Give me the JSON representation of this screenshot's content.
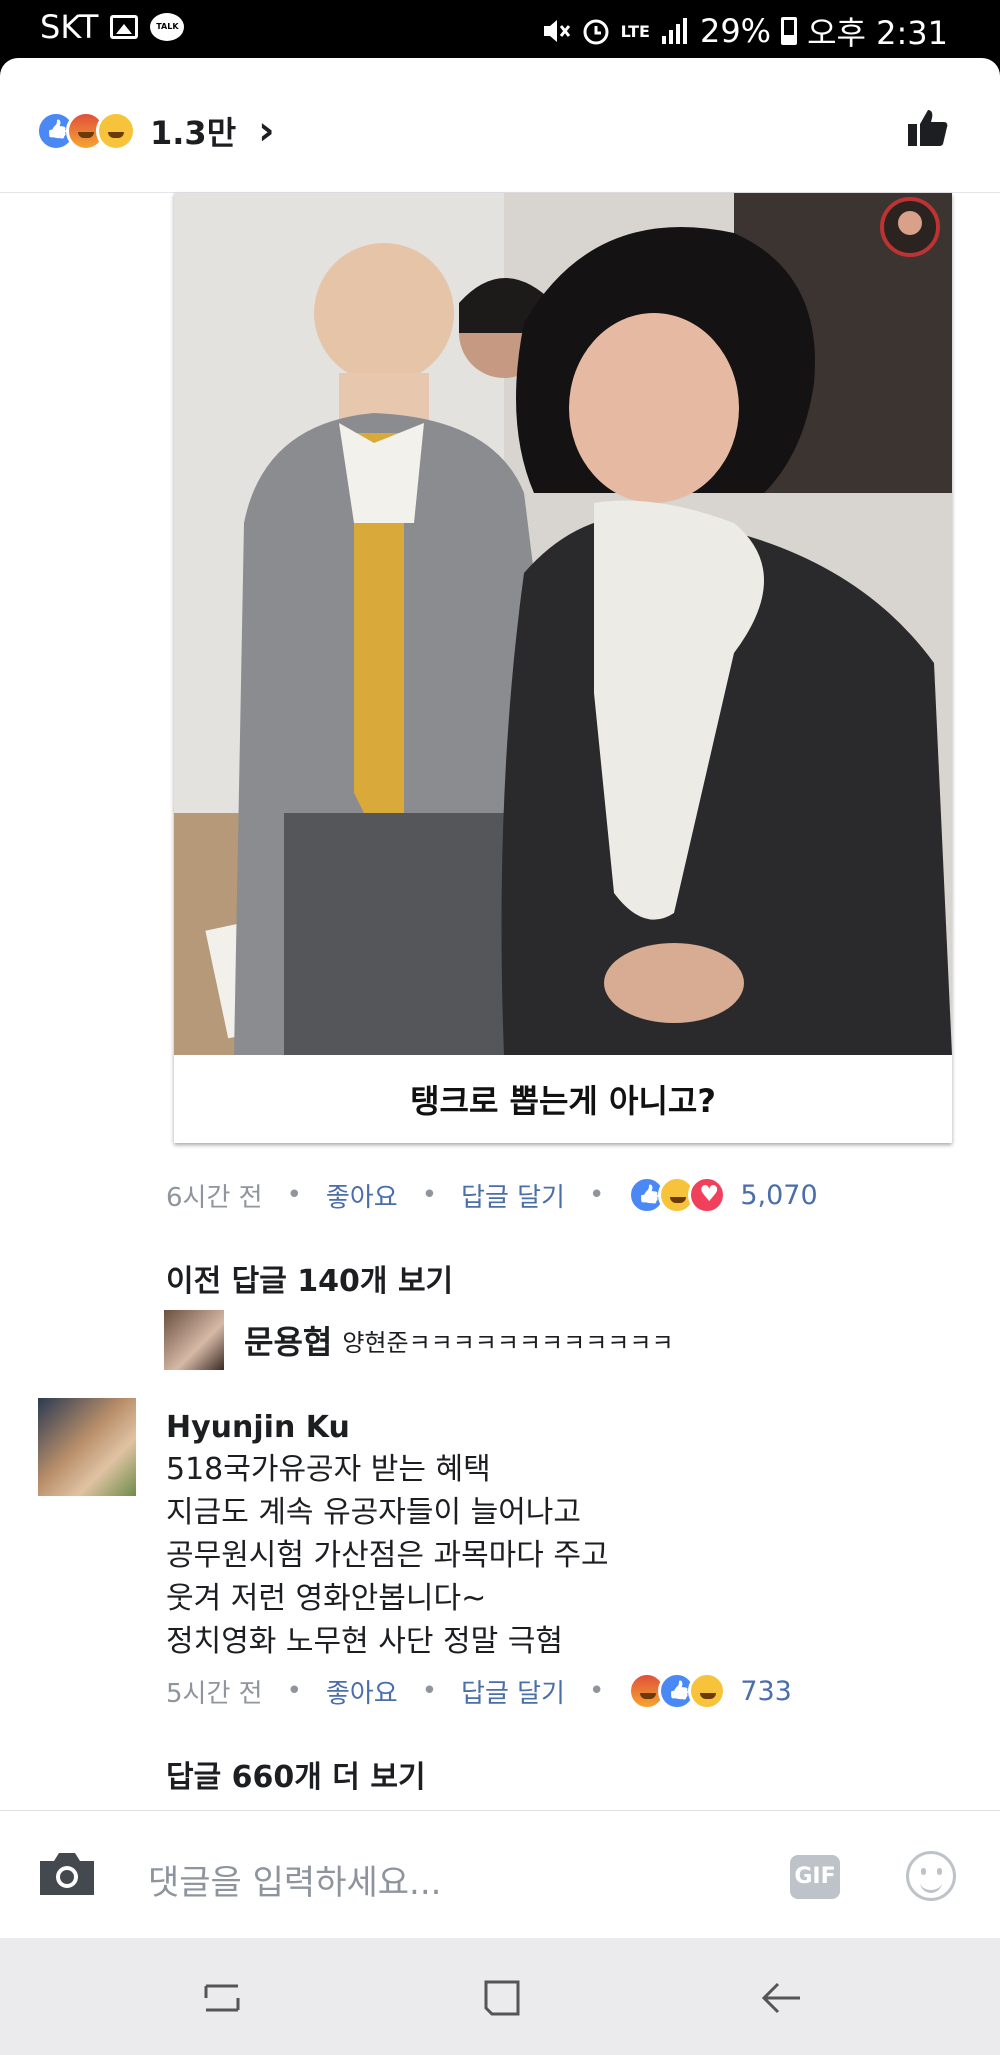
{
  "status_bar": {
    "carrier": "SKT",
    "talk_badge": "TALK",
    "network": "LTE",
    "battery": "29%",
    "time": "오후 2:31"
  },
  "post": {
    "reaction_total": "1.3만",
    "image_caption": "탱크로 뽑는게 아니고?"
  },
  "post_meta": {
    "time": "6시간 전",
    "like_label": "좋아요",
    "reply_label": "답글 달기",
    "reaction_count": "5,070"
  },
  "previous_replies_label": "이전 답글 140개 보기",
  "reply": {
    "author": "문용협",
    "text": "양현준ㅋㅋㅋㅋㅋㅋㅋㅋㅋㅋㅋㅋ"
  },
  "comment": {
    "author": "Hyunjin Ku",
    "lines": [
      "518국가유공자 받는 혜택",
      "지금도 계속 유공자들이 늘어나고",
      "공무원시험 가산점은 과목마다 주고",
      "웃겨 저런 영화안봅니다~",
      "정치영화 노무현 사단 정말 극혐"
    ],
    "time": "5시간 전",
    "like_label": "좋아요",
    "reply_label": "답글 달기",
    "reaction_count": "733"
  },
  "more_replies_label": "답글 660개 더 보기",
  "composer": {
    "placeholder": "댓글을 입력하세요...",
    "gif_label": "GIF"
  },
  "colors": {
    "fb_blue": "#4a88f5",
    "link_blue": "#4a6ea9",
    "meta_gray": "#90949c"
  },
  "icons": [
    "image-icon",
    "talk-icon",
    "mute-icon",
    "alarm-icon",
    "signal-icon",
    "battery-icon",
    "chevron-right-icon",
    "thumbs-up-icon",
    "camera-icon",
    "gif-icon",
    "smiley-icon",
    "recent-apps-icon",
    "home-icon",
    "back-icon"
  ]
}
